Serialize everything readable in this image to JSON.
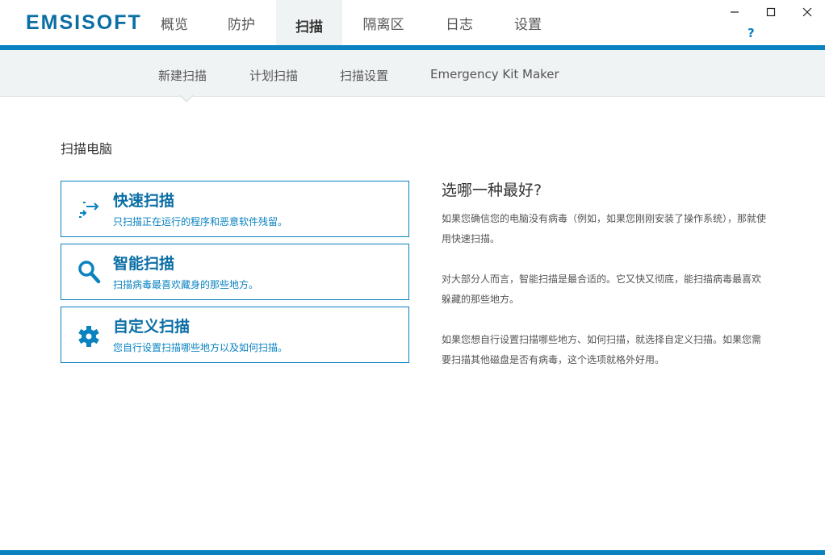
{
  "app": {
    "logo": "EMSISOFT",
    "help": "?"
  },
  "main_tabs": [
    {
      "label": "概览",
      "active": false
    },
    {
      "label": "防护",
      "active": false
    },
    {
      "label": "扫描",
      "active": true
    },
    {
      "label": "隔离区",
      "active": false
    },
    {
      "label": "日志",
      "active": false
    },
    {
      "label": "设置",
      "active": false
    }
  ],
  "sub_tabs": [
    {
      "label": "新建扫描",
      "active": true
    },
    {
      "label": "计划扫描",
      "active": false
    },
    {
      "label": "扫描设置",
      "active": false
    },
    {
      "label": "Emergency Kit Maker",
      "active": false
    }
  ],
  "section_title": "扫描电脑",
  "options": [
    {
      "title": "快速扫描",
      "desc": "只扫描正在运行的程序和恶意软件残留。",
      "icon": "quick-scan-icon"
    },
    {
      "title": "智能扫描",
      "desc": "扫描病毒最喜欢藏身的那些地方。",
      "icon": "search-icon"
    },
    {
      "title": "自定义扫描",
      "desc": "您自行设置扫描哪些地方以及如何扫描。",
      "icon": "gear-icon"
    }
  ],
  "help_panel": {
    "title": "选哪一种最好?",
    "paragraphs": [
      "如果您确信您的电脑没有病毒（例如，如果您刚刚安装了操作系统），那就使用快速扫描。",
      "对大部分人而言，智能扫描是最合适的。它又快又彻底，能扫描病毒最喜欢躲藏的那些地方。",
      "如果您想自行设置扫描哪些地方、如何扫描，就选择自定义扫描。如果您需要扫描其他磁盘是否有病毒，这个选项就格外好用。"
    ]
  },
  "colors": {
    "accent": "#0a82c0",
    "logo": "#0a6ea5",
    "subnav_bg": "#f0f3f4"
  }
}
